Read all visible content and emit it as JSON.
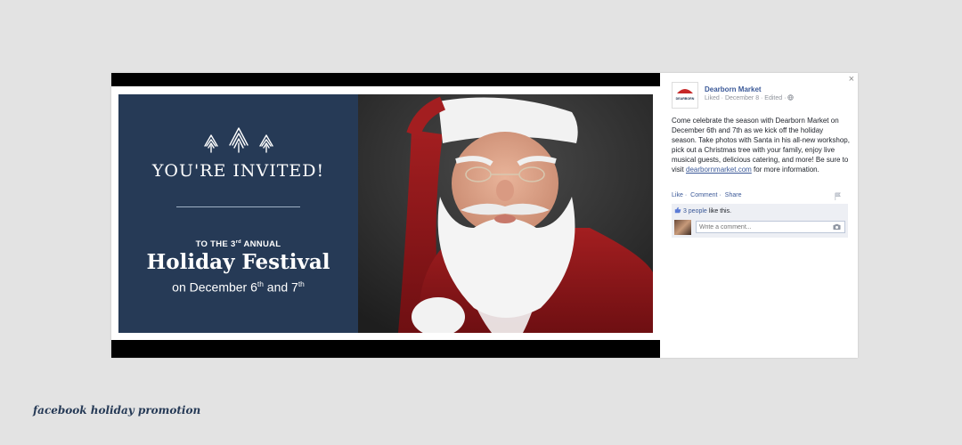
{
  "promo": {
    "headline": "YOU'RE INVITED!",
    "annual_prefix": "TO THE 3",
    "annual_sup": "rd",
    "annual_suffix": " ANNUAL",
    "event": "Holiday Festival",
    "dates_prefix": "on December 6",
    "dates_sup1": "th",
    "dates_mid": " and 7",
    "dates_sup2": "th",
    "bg_color": "#263a56"
  },
  "post": {
    "page_name": "Dearborn Market",
    "logo_text": "DEARBORN",
    "meta": "Liked · December 8 · Edited ·",
    "text": "Come celebrate the season with Dearborn Market on December 6th and 7th as we kick off the holiday season. Take photos with Santa in his all-new workshop, pick out a Christmas tree with your family, enjoy live musical guests, delicious catering, and more! Be sure to visit ",
    "link": "dearbornmarket.com",
    "text_after": " for more information.",
    "actions": {
      "like": "Like",
      "sep": "·",
      "comment": "Comment",
      "share": "Share"
    },
    "likes_count": "3 people",
    "likes_suffix": " like this.",
    "comment_placeholder": "Write a comment...",
    "link_color": "#3b5998"
  },
  "close_label": "×",
  "caption": "facebook holiday promotion"
}
